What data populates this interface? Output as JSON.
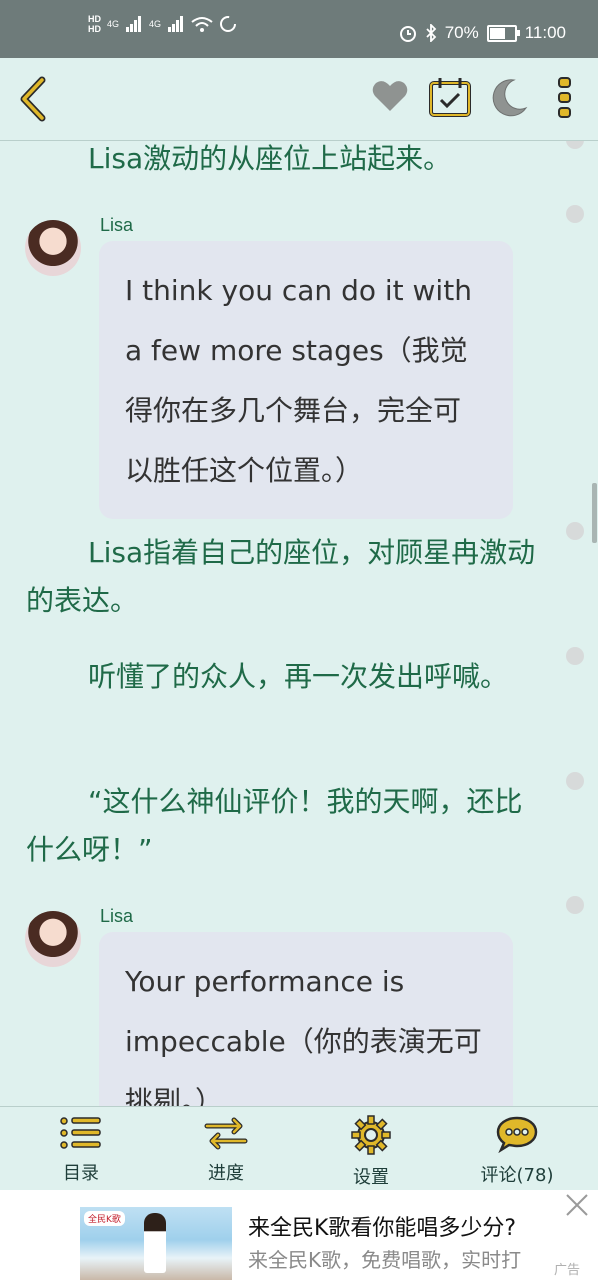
{
  "status_bar": {
    "hd1": "HD",
    "hd2": "HD",
    "net1": "4G",
    "net2": "4G",
    "battery": "70%",
    "battery_level": 0.7,
    "time": "11:00"
  },
  "toolbar": {
    "back_icon": "back-chevron-icon",
    "icons": [
      "heart-icon",
      "calendar-check-icon",
      "moon-icon",
      "more-vertical-icon"
    ]
  },
  "content": {
    "p1": "Lisa激动的从座位上站起来。",
    "msg1": {
      "speaker": "Lisa",
      "text": "I think you can do it with a few more stages（我觉得你在多几个舞台，完全可以胜任这个位置。）"
    },
    "p2": "Lisa指着自己的座位，对顾星冉激动的表达。",
    "p3": "听懂了的众人，再一次发出呼喊。",
    "p4": "“这什么神仙评价！我的天啊，还比什么呀！”",
    "msg2": {
      "speaker": "Lisa",
      "text": "Your performance is impeccable（你的表演无可挑剔。）"
    }
  },
  "bottom_nav": [
    {
      "label": "目录",
      "icon": "list-icon"
    },
    {
      "label": "进度",
      "icon": "progress-arrows-icon"
    },
    {
      "label": "设置",
      "icon": "gear-icon"
    },
    {
      "label": "评论(78)",
      "icon": "comment-icon"
    }
  ],
  "ad": {
    "badge": "全民K歌",
    "title": "来全民K歌看你能唱多少分?",
    "subtitle": "来全民K歌，免费唱歌，实时打",
    "mark": "广告"
  },
  "colors": {
    "background": "#dff1ee",
    "text_green": "#1f6a48",
    "accent_yellow": "#e0b82a",
    "status_bar": "#6e7b7a"
  }
}
